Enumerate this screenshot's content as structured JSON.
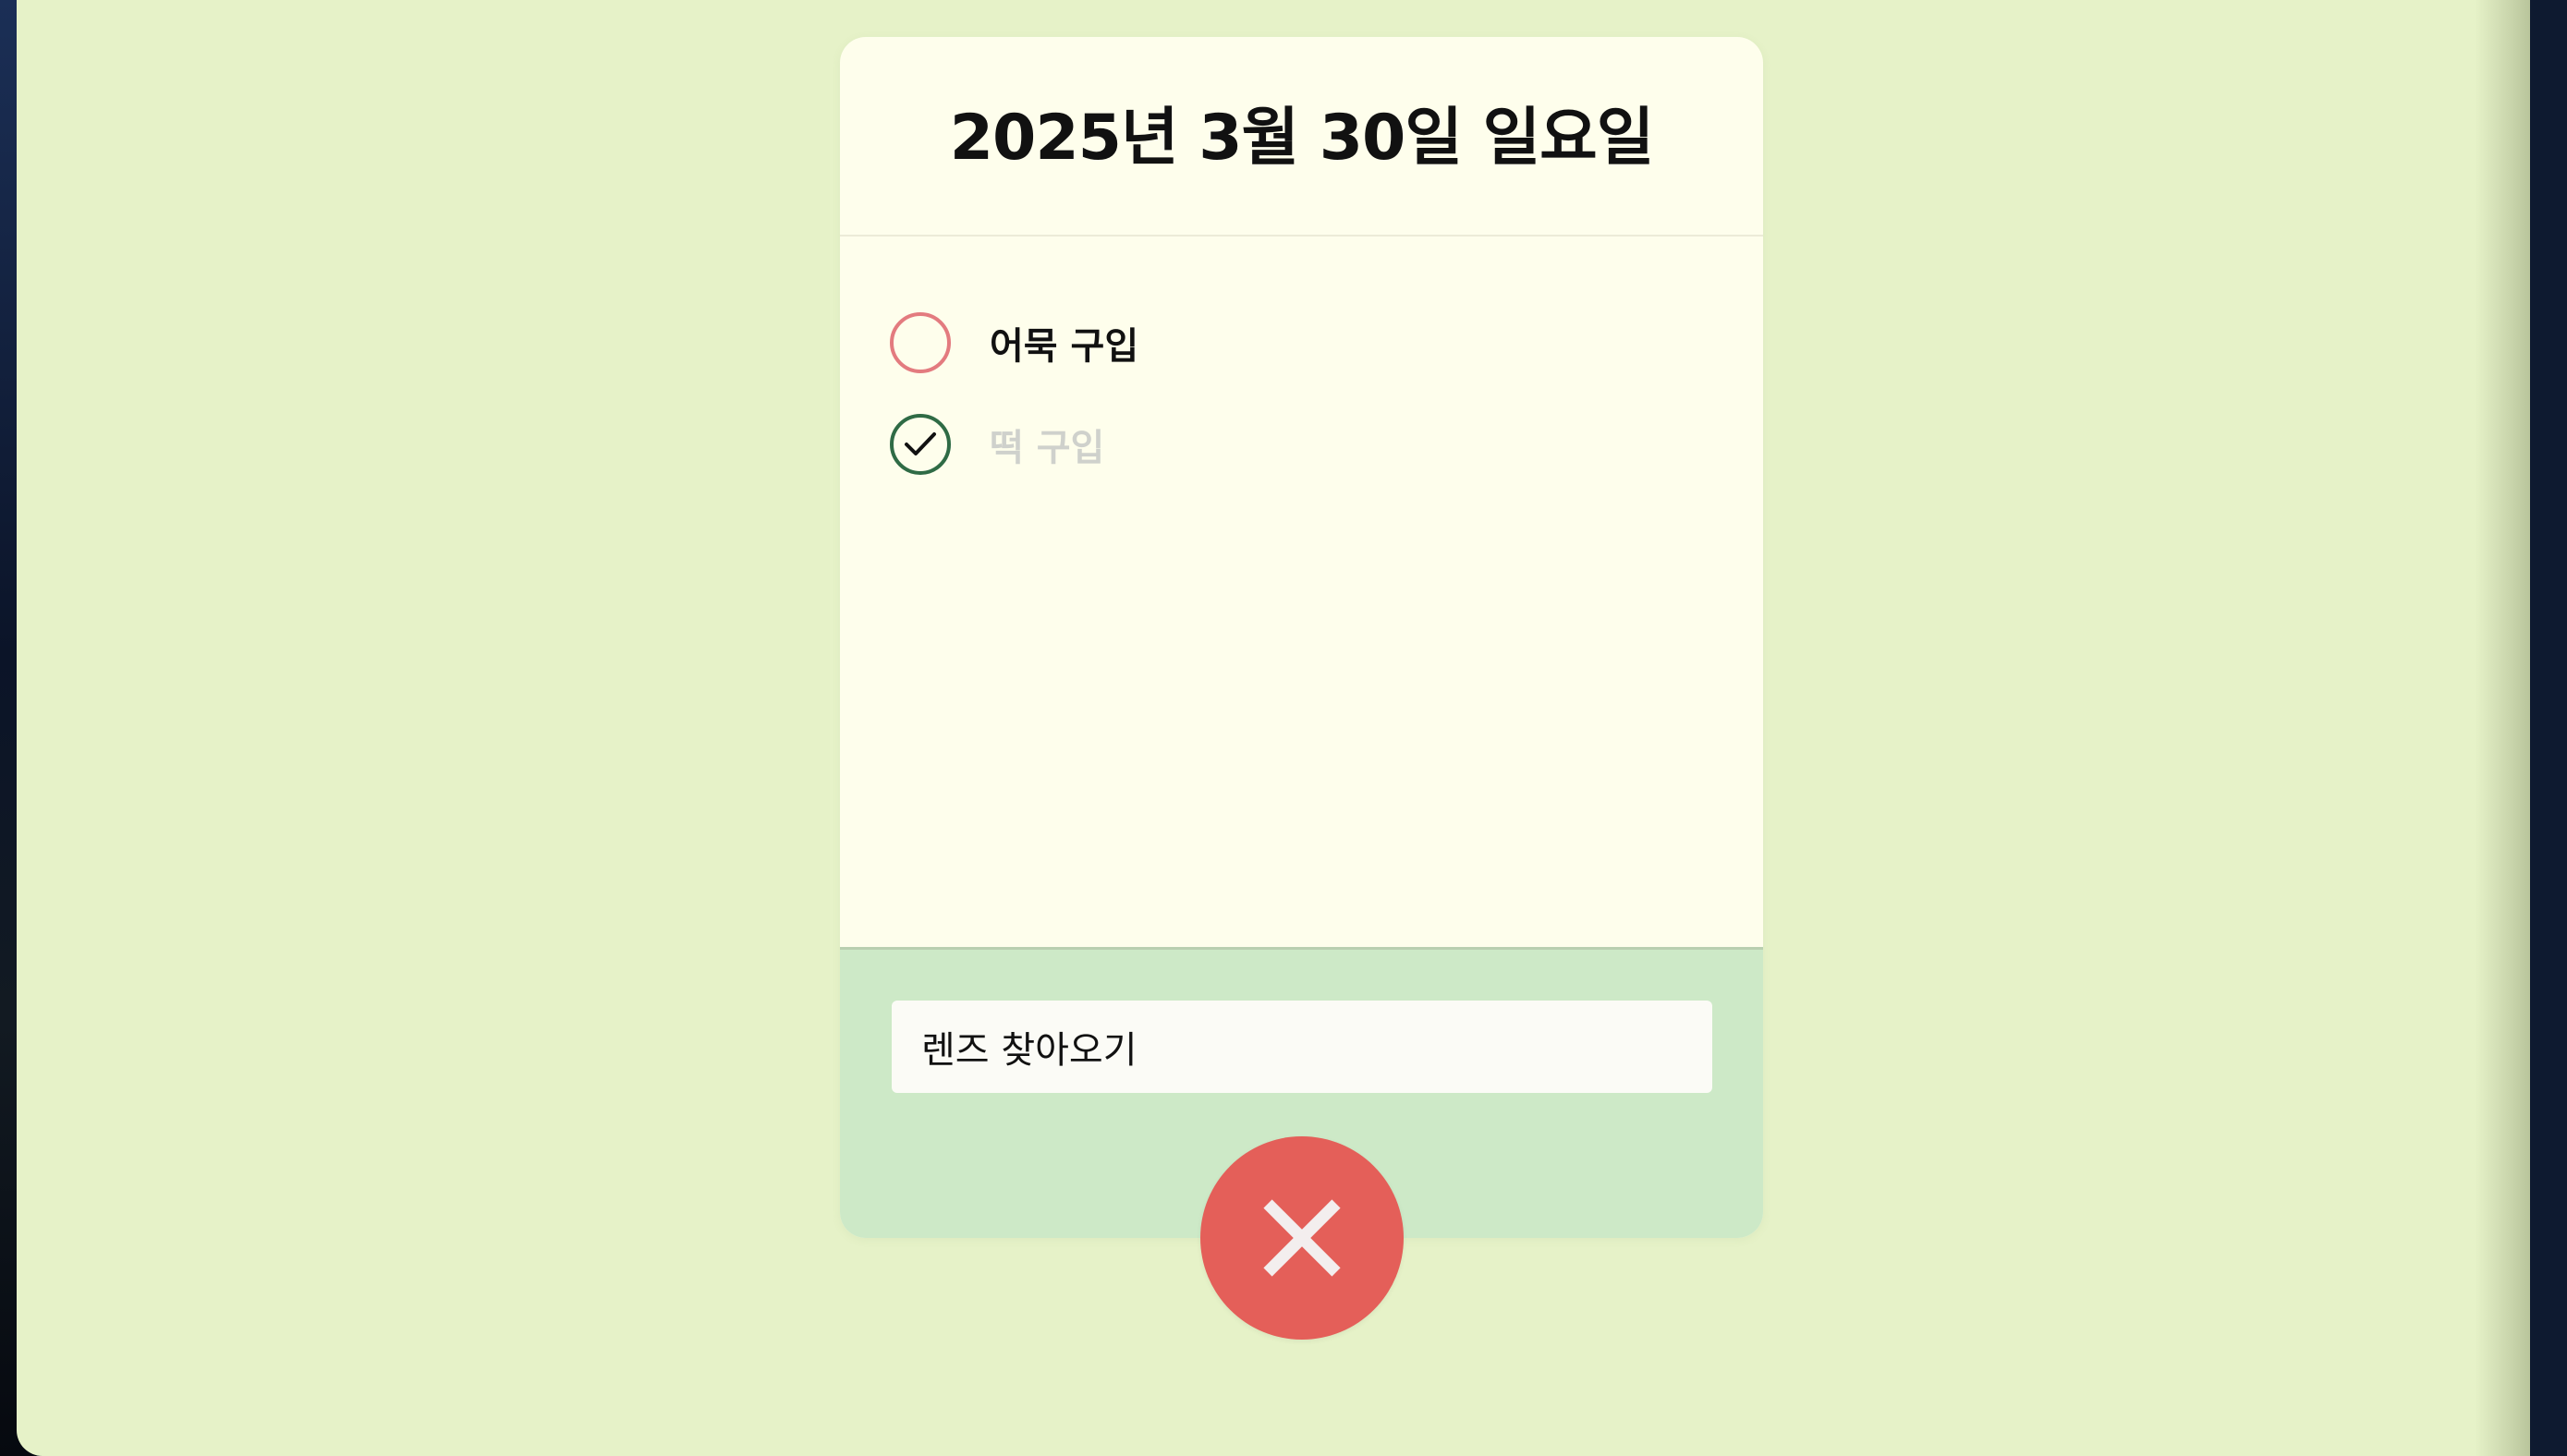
{
  "card": {
    "title": "2025년 3월 30일 일요일"
  },
  "todos": [
    {
      "text": "어묵 구입",
      "done": false
    },
    {
      "text": "떡 구입",
      "done": true
    }
  ],
  "input": {
    "value": "렌즈 찾아오기"
  },
  "icons": {
    "close": "close-icon",
    "check": "checkmark-icon"
  },
  "colors": {
    "page_background": "#e6f2c8",
    "card_background": "#fefeec",
    "footer_background": "#cde9c7",
    "close_button": "#e45f59",
    "unchecked_circle": "#e37b7f",
    "checked_circle": "#2f6b45",
    "done_text": "#cfd1cc"
  }
}
